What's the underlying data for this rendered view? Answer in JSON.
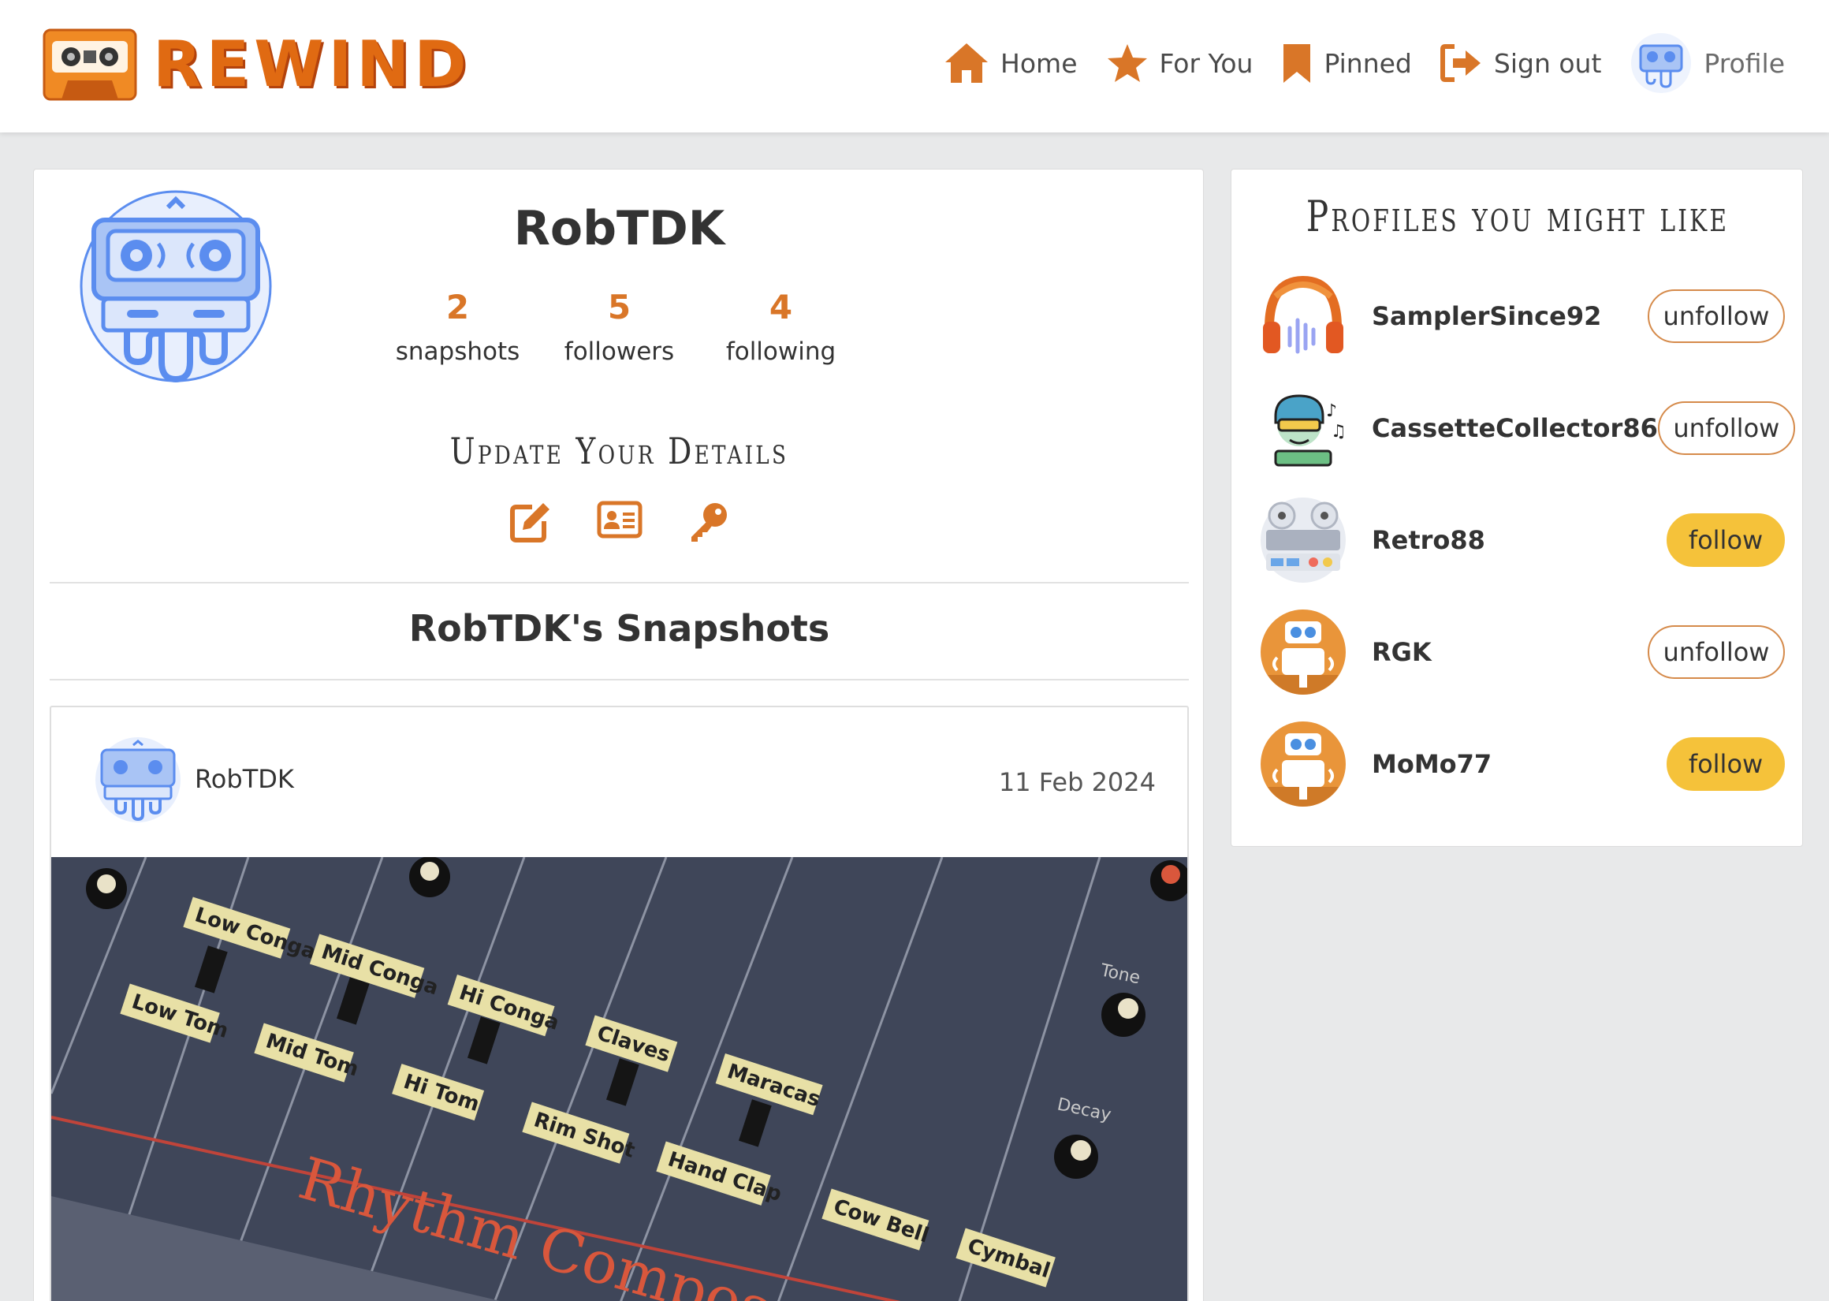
{
  "brand": {
    "name": "REWIND"
  },
  "nav": {
    "items": [
      {
        "label": "Home",
        "icon": "home-icon"
      },
      {
        "label": "For You",
        "icon": "star-icon"
      },
      {
        "label": "Pinned",
        "icon": "bookmark-icon"
      },
      {
        "label": "Sign out",
        "icon": "sign-out-icon"
      },
      {
        "label": "Profile",
        "icon": "avatar-icon"
      }
    ]
  },
  "profile": {
    "username": "RobTDK",
    "stats": [
      {
        "value": "2",
        "label": "snapshots"
      },
      {
        "value": "5",
        "label": "followers"
      },
      {
        "value": "4",
        "label": "following"
      }
    ],
    "update_title": "Update Your Details",
    "update_icons": [
      "edit-icon",
      "id-card-icon",
      "key-icon"
    ],
    "snapshots_heading": "RobTDK's Snapshots"
  },
  "post": {
    "username": "RobTDK",
    "date": "11 Feb 2024",
    "image_labels": [
      "Low Conga",
      "Mid Conga",
      "Hi Conga",
      "Claves",
      "Maracas",
      "Low Tom",
      "Mid Tom",
      "Hi Tom",
      "Rim Shot",
      "Hand Clap",
      "Cow Bell",
      "Cymbal",
      "Tone",
      "Decay",
      "Rhythm Compose"
    ]
  },
  "sidebar": {
    "title": "Profiles you might like",
    "profiles": [
      {
        "name": "SamplerSince92",
        "action": "unfollow"
      },
      {
        "name": "CassetteCollector86",
        "action": "unfollow"
      },
      {
        "name": "Retro88",
        "action": "follow"
      },
      {
        "name": "RGK",
        "action": "unfollow"
      },
      {
        "name": "MoMo77",
        "action": "follow"
      }
    ]
  },
  "colors": {
    "accent": "#d97628",
    "follow_button": "#f5c23a",
    "avatar_blue": "#5b8def"
  }
}
